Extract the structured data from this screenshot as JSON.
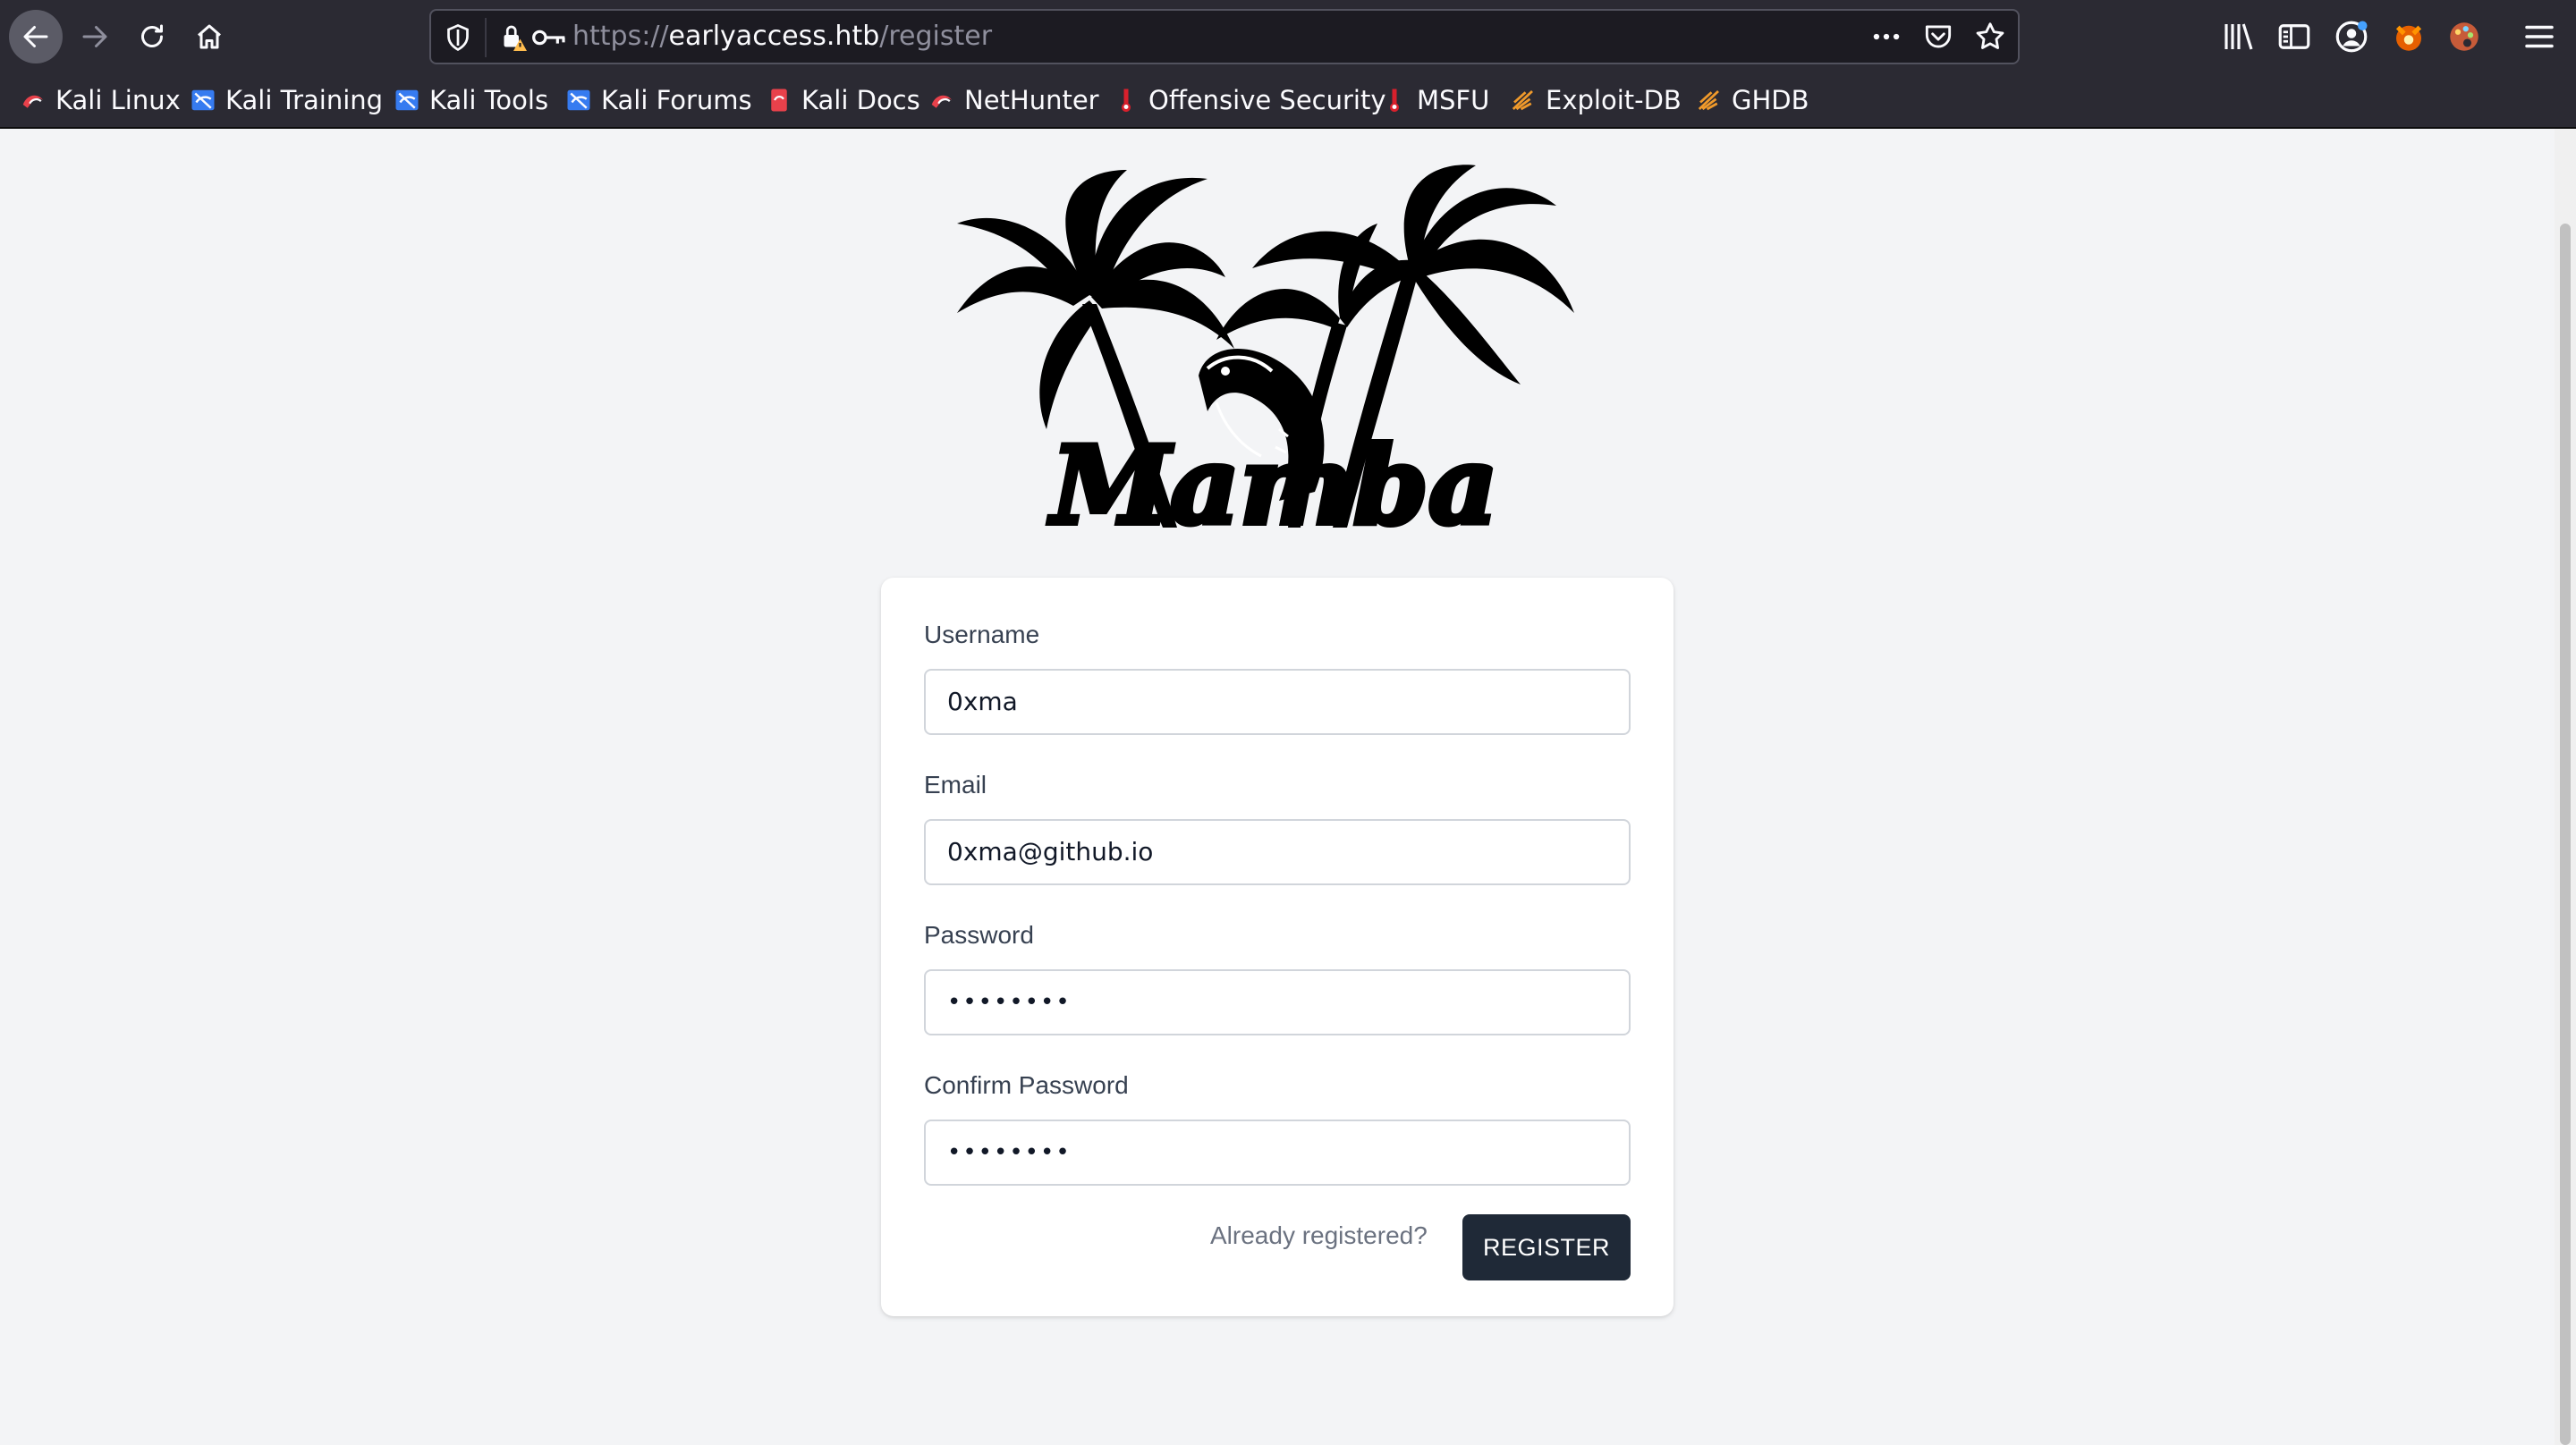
{
  "browser": {
    "url_scheme": "https://",
    "url_host": "earlyaccess.htb",
    "url_path": "/register",
    "bookmarks": [
      {
        "label": "Kali Linux",
        "icon": "kali-dragon-icon"
      },
      {
        "label": "Kali Training",
        "icon": "kali-training-icon"
      },
      {
        "label": "Kali Tools",
        "icon": "kali-tools-icon"
      },
      {
        "label": "Kali Forums",
        "icon": "kali-forums-icon"
      },
      {
        "label": "Kali Docs",
        "icon": "kali-docs-icon"
      },
      {
        "label": "NetHunter",
        "icon": "nethunter-icon"
      },
      {
        "label": "Offensive Security",
        "icon": "offsec-icon"
      },
      {
        "label": "MSFU",
        "icon": "msfu-icon"
      },
      {
        "label": "Exploit-DB",
        "icon": "exploitdb-icon"
      },
      {
        "label": "GHDB",
        "icon": "ghdb-icon"
      }
    ]
  },
  "logo": {
    "text": "Mamba"
  },
  "form": {
    "username_label": "Username",
    "username_value": "0xma",
    "email_label": "Email",
    "email_value": "0xma@github.io",
    "password_label": "Password",
    "password_value": "••••••••",
    "confirm_label": "Confirm Password",
    "confirm_value": "••••••••",
    "already_registered": "Already registered?",
    "register_button": "REGISTER"
  },
  "colors": {
    "page_bg": "#f3f4f6",
    "card_bg": "#ffffff",
    "button_bg": "#1f2937",
    "chrome_bg": "#2b2a33"
  }
}
